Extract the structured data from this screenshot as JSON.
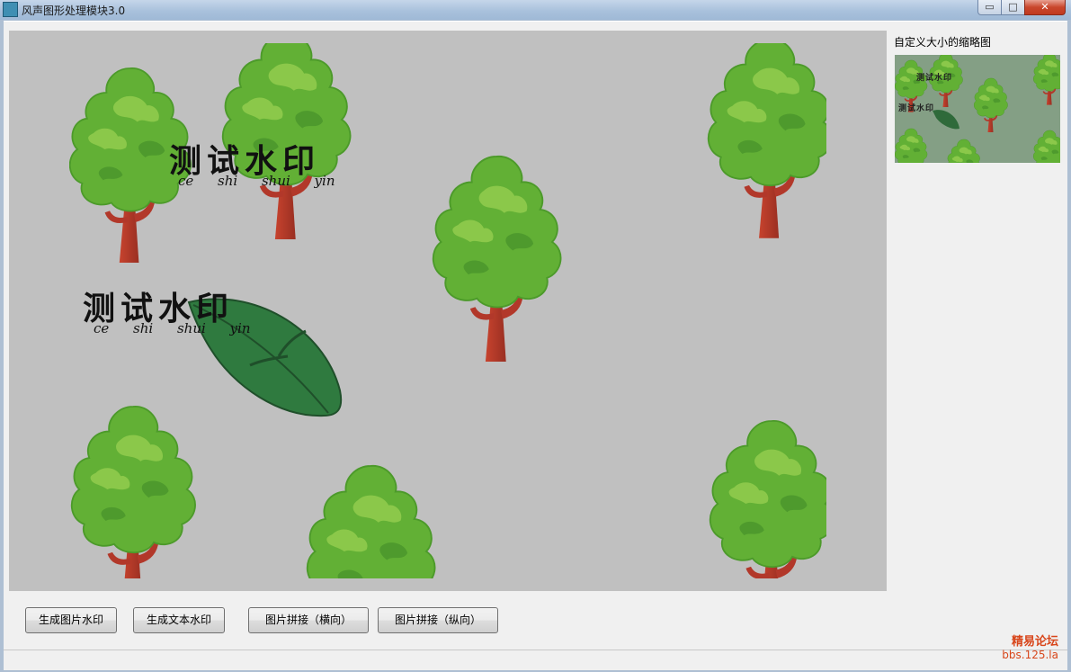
{
  "window": {
    "title": "风声图形处理模块3.0",
    "min_glyph": "▭",
    "max_glyph": "□",
    "close_glyph": "✕"
  },
  "canvas": {
    "background": "#c0c0c0",
    "watermarks": [
      {
        "text": "测试水印",
        "pinyin": "ce shi shui yin"
      },
      {
        "text": "测试水印",
        "pinyin": "ce shi shui yin"
      }
    ]
  },
  "thumbnail": {
    "label": "自定义大小的缩略图",
    "watermarks": [
      "测试水印",
      "测试水印"
    ]
  },
  "buttons": {
    "image_watermark": "生成图片水印",
    "text_watermark": "生成文本水印",
    "stitch_horizontal": "图片拼接（横向）",
    "stitch_vertical": "图片拼接（纵向）"
  },
  "brand": {
    "name": "精易论坛",
    "url": "bbs.125.la"
  },
  "colors": {
    "tree_leaf": "#62b035",
    "tree_leaf_light": "#8bc84a",
    "tree_trunk": "#b2382a",
    "leaf": "#2f7a3f",
    "brand": "#d8461b"
  }
}
